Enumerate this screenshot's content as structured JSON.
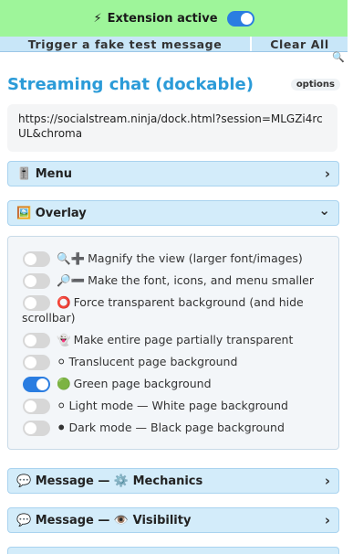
{
  "topbar": {
    "bolt_icon": "⚡",
    "status_label": "Extension active",
    "enabled": true
  },
  "actions": {
    "trigger_label": "Trigger a fake test message",
    "clear_label": "Clear All"
  },
  "search": {
    "icon": "🔍"
  },
  "header": {
    "title": "Streaming chat (dockable)",
    "options_label": "options"
  },
  "url": "https://socialstream.ninja/dock.html?session=MLGZi4rcUL&chroma",
  "sections": {
    "menu": {
      "icon": "🎚️",
      "label": "Menu",
      "chevron": "›"
    },
    "overlay": {
      "icon": "🖼️",
      "label": "Overlay",
      "chevron": "⌄"
    },
    "mechanics": {
      "icon": "💬",
      "label": "Message — ⚙️ Mechanics",
      "chevron": "›"
    },
    "visibility": {
      "icon": "💬",
      "label": "Message — 👁️ Visibility",
      "chevron": "›"
    }
  },
  "overlay_options": [
    {
      "icon": "🔍➕",
      "label": "Magnify the view (larger font/images)",
      "on": false
    },
    {
      "icon": "🔎➖",
      "label": "Make the font, icons, and menu smaller",
      "on": false
    },
    {
      "icon": "⭕",
      "label": "Force transparent background (and hide",
      "label2": "scrollbar)",
      "on": false
    },
    {
      "icon": "👻",
      "label": "Make entire page partially transparent",
      "on": false
    },
    {
      "icon": "⚪",
      "label": "Translucent page background",
      "on": false
    },
    {
      "icon": "🟢",
      "label": "Green page background",
      "on": true
    },
    {
      "icon": "⚪",
      "label": "Light mode — White page background",
      "on": false
    },
    {
      "icon": "⚫",
      "label": "Dark mode — Black page background",
      "on": false
    }
  ]
}
